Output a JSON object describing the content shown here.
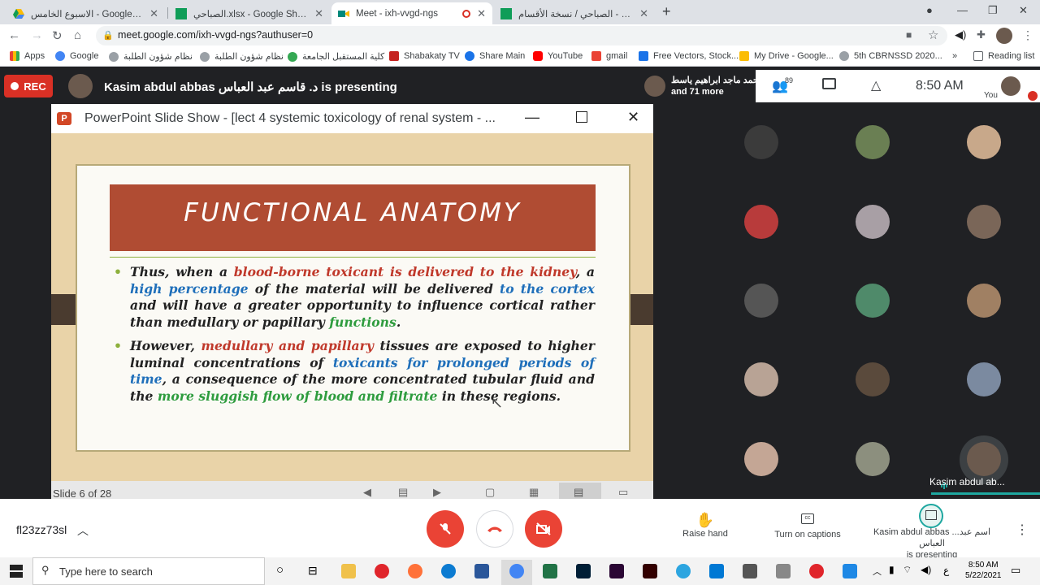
{
  "browser": {
    "tabs": [
      {
        "title": "الاسبوع الخامس - Google Drive",
        "icon": "google-drive-icon",
        "active": false
      },
      {
        "title": "الصباحي.xlsx - Google Sheets",
        "icon": "google-sheets-icon",
        "active": false
      },
      {
        "title": "Meet - ixh-vvgd-ngs",
        "icon": "google-meet-icon",
        "active": true
      },
      {
        "title": "الصباحي / نسخة الأقسام - Google Sheets",
        "icon": "google-sheets-icon",
        "active": false
      }
    ],
    "url": "meet.google.com/ixh-vvgd-ngs?authuser=0",
    "bookmarks": [
      {
        "label": "Apps",
        "icon": "apps-grid-icon"
      },
      {
        "label": "Google",
        "icon": "google-icon"
      },
      {
        "label": "نظام شؤون الطلبة",
        "icon": "globe-icon"
      },
      {
        "label": "نظام شؤون الطلبة",
        "icon": "globe-icon"
      },
      {
        "label": "كلية المستقبل الجامعة",
        "icon": "college-icon"
      },
      {
        "label": "Shabakaty TV",
        "icon": "tv-icon"
      },
      {
        "label": "Share Main",
        "icon": "share-icon"
      },
      {
        "label": "YouTube",
        "icon": "youtube-icon"
      },
      {
        "label": "gmail",
        "icon": "gmail-icon"
      },
      {
        "label": "Free Vectors, Stock...",
        "icon": "freepik-icon"
      },
      {
        "label": "My Drive - Google...",
        "icon": "google-drive-icon"
      },
      {
        "label": "5th CBRNSSD 2020...",
        "icon": "globe-icon"
      }
    ],
    "bookmarks_more": "»",
    "reading_list": "Reading list"
  },
  "meet": {
    "rec_label": "REC",
    "presenter_banner": "Kasim abdul abbas د. قاسم عبد العباس is presenting",
    "joined_name": "احمد ماجد ابراهيم ياسط",
    "joined_more": "and 71 more",
    "participant_count": "89",
    "time": "8:50 AM",
    "you_label": "You",
    "speaker_name": "Kasim abdul ab...",
    "meeting_code": "fl23zz73sl",
    "actions": {
      "raise_hand": "Raise hand",
      "captions": "Turn on captions",
      "presenting_line1": "Kasim abdul abbas ...اسم عبد العباس",
      "presenting_line2": "is presenting"
    }
  },
  "powerpoint": {
    "window_title": "PowerPoint Slide Show - [lect 4 systemic toxicology of renal system - ...",
    "slide_counter": "Slide 6 of 28",
    "slide": {
      "title": "FUNCTIONAL ANATOMY",
      "bullet1": {
        "s1": "Thus, when a ",
        "s2": "blood-borne toxicant is delivered to the kidney",
        "s3": ", a ",
        "s4": "high percentage",
        "s5": " of the material will be delivered ",
        "s6": "to the cortex",
        "s7": " and will have a greater opportunity to influence cortical rather than medullary or papillary ",
        "s8": "functions",
        "s9": "."
      },
      "bullet2": {
        "s1": "However, ",
        "s2": "medullary and papillary",
        "s3": " tissues are exposed to higher luminal concentrations of ",
        "s4": "toxicants for prolonged periods of time",
        "s5": ", a consequence of the more concentrated tubular fluid and the ",
        "s6": "more sluggish flow of blood and filtrate",
        "s7": " in these regions."
      }
    }
  },
  "taskbar": {
    "search_placeholder": "Type here to search",
    "time": "8:50 AM",
    "date": "5/22/2021",
    "lang": "ع"
  },
  "colors": {
    "rec": "#d93025",
    "title_band": "#b04c33",
    "slide_bg": "#e9d3a8",
    "call_button": "#ea4335"
  }
}
